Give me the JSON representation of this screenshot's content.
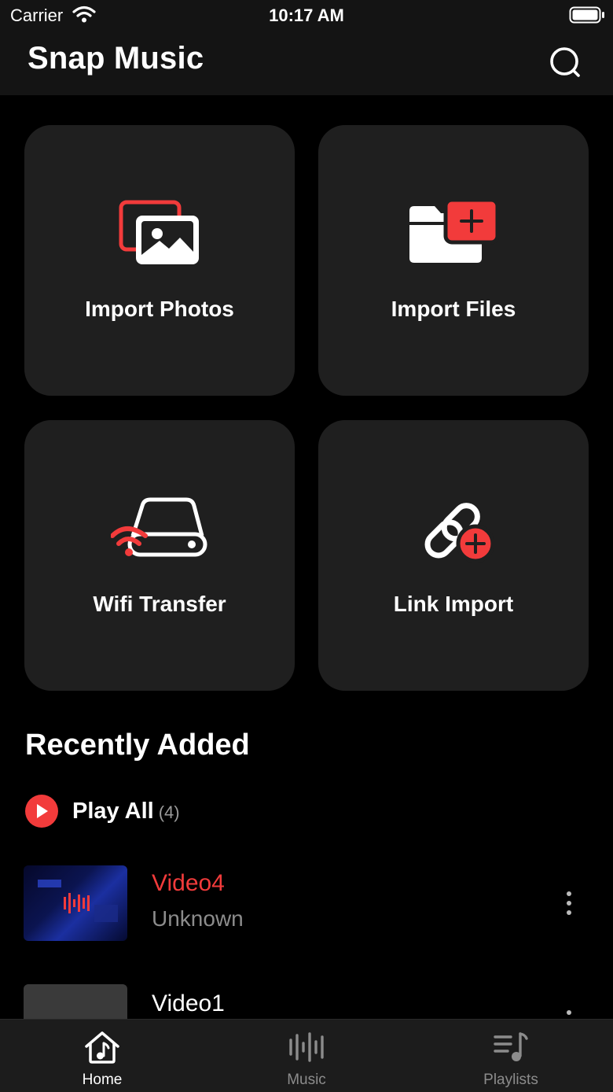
{
  "status_bar": {
    "carrier": "Carrier",
    "time": "10:17 AM"
  },
  "header": {
    "title": "Snap Music",
    "search_icon": "search-icon"
  },
  "import_cards": [
    {
      "label": "Import Photos",
      "icon": "photos-icon"
    },
    {
      "label": "Import Files",
      "icon": "folder-add-icon"
    },
    {
      "label": "Wifi Transfer",
      "icon": "wifi-transfer-icon"
    },
    {
      "label": "Link Import",
      "icon": "link-add-icon"
    }
  ],
  "recent": {
    "title": "Recently Added",
    "play_all_label": "Play All",
    "play_all_count": "(4)",
    "items": [
      {
        "title": "Video4",
        "subtitle": "Unknown",
        "playing": true
      },
      {
        "title": "Video1",
        "subtitle": "",
        "playing": false
      }
    ]
  },
  "tabbar": {
    "tabs": [
      {
        "label": "Home",
        "icon": "home-music-icon",
        "active": true
      },
      {
        "label": "Music",
        "icon": "waveform-icon",
        "active": false
      },
      {
        "label": "Playlists",
        "icon": "playlist-icon",
        "active": false
      }
    ]
  },
  "colors": {
    "accent": "#f23b3b",
    "background": "#000000",
    "card": "#1f1f1f",
    "muted": "#8c8c8c"
  }
}
